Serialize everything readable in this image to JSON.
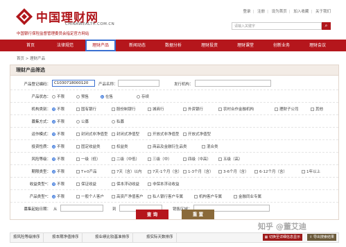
{
  "header": {
    "logo_cn": "中国理财网",
    "logo_en": "CHINAWEALTH.COM.CN",
    "logo_sub": "中国银行保险监督管理委员会指定官方网站",
    "links": [
      "登录",
      "注册",
      "设为首页",
      "加入收藏",
      "关于我们"
    ],
    "search_placeholder": "请输入关键字"
  },
  "nav": {
    "items": [
      "首页",
      "法律规范",
      "理财产品",
      "新闻动态",
      "数据分析",
      "理财投资",
      "理财课堂",
      "创新业务",
      "理财会议"
    ],
    "active_index": 2
  },
  "breadcrumb": "首页 > 理财产品",
  "panel": {
    "title": "理财产品筛选",
    "row1": {
      "code_label": "产品登记编码：",
      "code_value": "C1030718000120",
      "name_label": "产品名称：",
      "name_value": "",
      "issuer_label": "发行机构：",
      "issuer_value": ""
    },
    "status": {
      "label": "产品状态：",
      "options": [
        "不限",
        "预售",
        "在售",
        "存续"
      ],
      "selected": 2
    },
    "org": {
      "label": "机构类别：",
      "options": [
        "不限",
        "国有银行",
        "股份制银行",
        "城商行",
        "外资银行",
        "农村合作金融机构",
        "理财子公司",
        "其他"
      ],
      "selected": 0
    },
    "raise": {
      "label": "募集方式：",
      "options": [
        "不限",
        "公募",
        "私募"
      ],
      "selected": 0
    },
    "operation": {
      "label": "运作模式：",
      "options": [
        "不限",
        "封闭式非净值型",
        "封闭式净值型",
        "开放式非净值型",
        "开放式净值型"
      ],
      "selected": 0
    },
    "invest": {
      "label": "投资性质：",
      "options": [
        "不限",
        "固定收益类",
        "权益类",
        "商品及金融衍生品类",
        "混合类"
      ],
      "selected": 0
    },
    "risk": {
      "label": "风险等级：",
      "options": [
        "不限",
        "一级（低）",
        "二级（中低）",
        "三级（中）",
        "四级（中高）",
        "五级（高）"
      ],
      "selected": 0
    },
    "term": {
      "label": "期限类型：",
      "options": [
        "不限",
        "T+0产品",
        "7天（含）以内",
        "7天-1个月（含）",
        "1-3个月（含）",
        "3-6个月（含）",
        "6-12个月（含）",
        "1年以上"
      ],
      "selected": 0
    },
    "income": {
      "label": "收益类型*：",
      "options": [
        "不限",
        "保证收益",
        "保本浮动收益",
        "非保本浮动收益"
      ],
      "selected": 0
    },
    "customer": {
      "label": "产品类型*：",
      "options": [
        "不限",
        "一般个人客户",
        "高资产净值客户",
        "私人银行客户专属",
        "机构客户专属",
        "金融同业专属"
      ],
      "selected": 0
    },
    "dates": {
      "label": "募集起始日期：",
      "from": "从",
      "to": "到",
      "region_label": "销售区域："
    },
    "buttons": {
      "query": "查 询",
      "reset": "重 置"
    }
  },
  "sortbar": {
    "items": [
      "按风险等级排序",
      "按本期净值排序",
      "按业绩比较基准排序",
      "按实际天数排序"
    ],
    "switch_label": "切换至详细信息显示",
    "export_label": "导出搜索结果"
  },
  "watermark": "知乎 @董艾迪",
  "colors": {
    "brand_red": "#b5161c",
    "focus_blue": "#3a6fd0"
  }
}
